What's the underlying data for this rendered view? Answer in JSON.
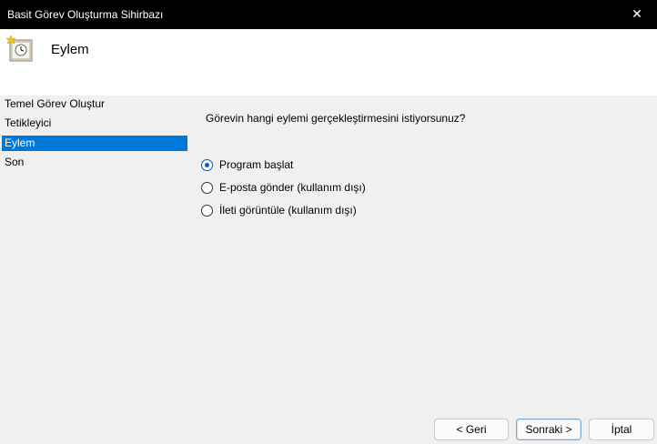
{
  "window": {
    "title": "Basit Görev Oluşturma Sihirbazı",
    "close_glyph": "✕"
  },
  "header": {
    "title": "Eylem",
    "icon": "task-clock-icon"
  },
  "sidebar": {
    "items": [
      {
        "label": "Temel Görev Oluştur",
        "selected": false
      },
      {
        "label": "Tetikleyici",
        "selected": false
      },
      {
        "label": "Eylem",
        "selected": true
      },
      {
        "label": "Son",
        "selected": false
      }
    ]
  },
  "main": {
    "question": "Görevin hangi eylemi gerçekleştirmesini istiyorsunuz?",
    "options": [
      {
        "label": "Program başlat",
        "checked": true
      },
      {
        "label": "E-posta gönder (kullanım dışı)",
        "checked": false
      },
      {
        "label": "İleti görüntüle (kullanım dışı)",
        "checked": false
      }
    ]
  },
  "buttons": {
    "back": "< Geri",
    "next": "Sonraki >",
    "cancel": "İptal"
  },
  "colors": {
    "selection": "#0078d7",
    "radio_accent": "#005fb8"
  }
}
